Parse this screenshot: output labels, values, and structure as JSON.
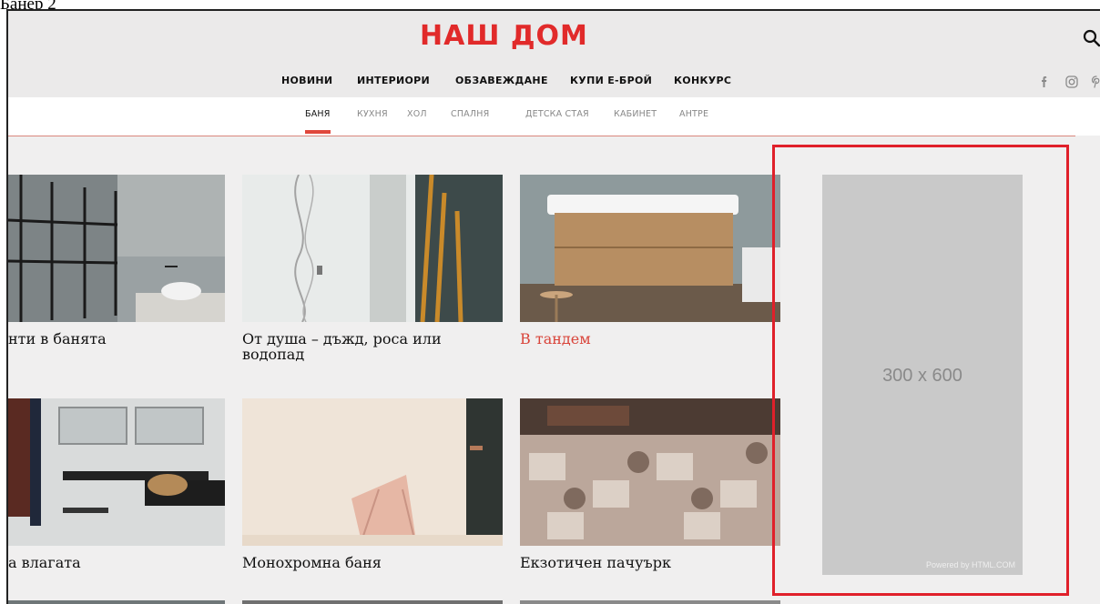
{
  "caption": "Банер 2",
  "logo": "НАШ ДОМ",
  "main_nav": [
    "НОВИНИ",
    "ИНТЕРИОРИ",
    "ОБЗАВЕЖДАНЕ",
    "КУПИ Е-БРОЙ",
    "КОНКУРС"
  ],
  "sub_nav": {
    "items": [
      "БАНЯ",
      "КУХНЯ",
      "ХОЛ",
      "СПАЛНЯ",
      "ДЕТСКА СТАЯ",
      "КАБИНЕТ",
      "АНТРЕ"
    ],
    "active": "БАНЯ"
  },
  "cards": [
    {
      "title": "нти в банята"
    },
    {
      "title": "От душа – дъжд, роса или водопад"
    },
    {
      "title": "В тандем"
    },
    {
      "title": "а влагата"
    },
    {
      "title": "Монохромна баня"
    },
    {
      "title": "Екзотичен пачуърк"
    }
  ],
  "ad": {
    "size_label": "300 x 600",
    "powered_by": "Powered by HTML.COM"
  },
  "icons": [
    "search-icon",
    "facebook-icon",
    "instagram-icon",
    "pinterest-icon"
  ],
  "colors": {
    "brand_red": "#e12a2a",
    "title_red": "#d9443a",
    "highlight_red": "#e0202a"
  }
}
